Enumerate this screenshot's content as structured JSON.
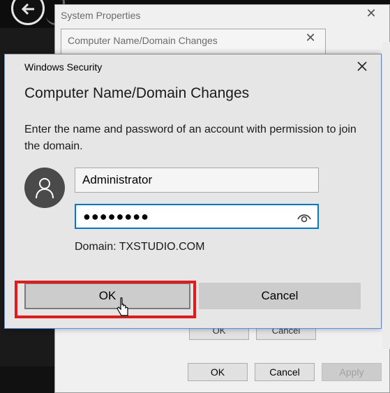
{
  "background": {
    "system_properties": {
      "title": "System Properties",
      "close_glyph": "✕",
      "ok_label": "OK",
      "cancel_label": "Cancel",
      "apply_label": "Apply"
    },
    "computer_name_window": {
      "title": "Computer Name/Domain Changes",
      "close_glyph": "✕",
      "ok_label": "OK",
      "cancel_label": "Cancel"
    }
  },
  "security_dialog": {
    "window_title": "Windows Security",
    "heading": "Computer Name/Domain Changes",
    "description": "Enter the name and password of an account with permission to join the domain.",
    "username_value": "Administrator",
    "password_mask": "●●●●●●●●",
    "domain_text": "Domain: TXSTUDIO.COM",
    "ok_label": "OK",
    "cancel_label": "Cancel"
  },
  "colors": {
    "highlight": "#e21a1a",
    "focus_border": "#0078d7",
    "dialog_bg": "#e6e6e6"
  },
  "icons": [
    "back-arrow-icon",
    "close-icon",
    "user-avatar-icon",
    "reveal-password-eye-icon",
    "mouse-cursor-icon"
  ]
}
